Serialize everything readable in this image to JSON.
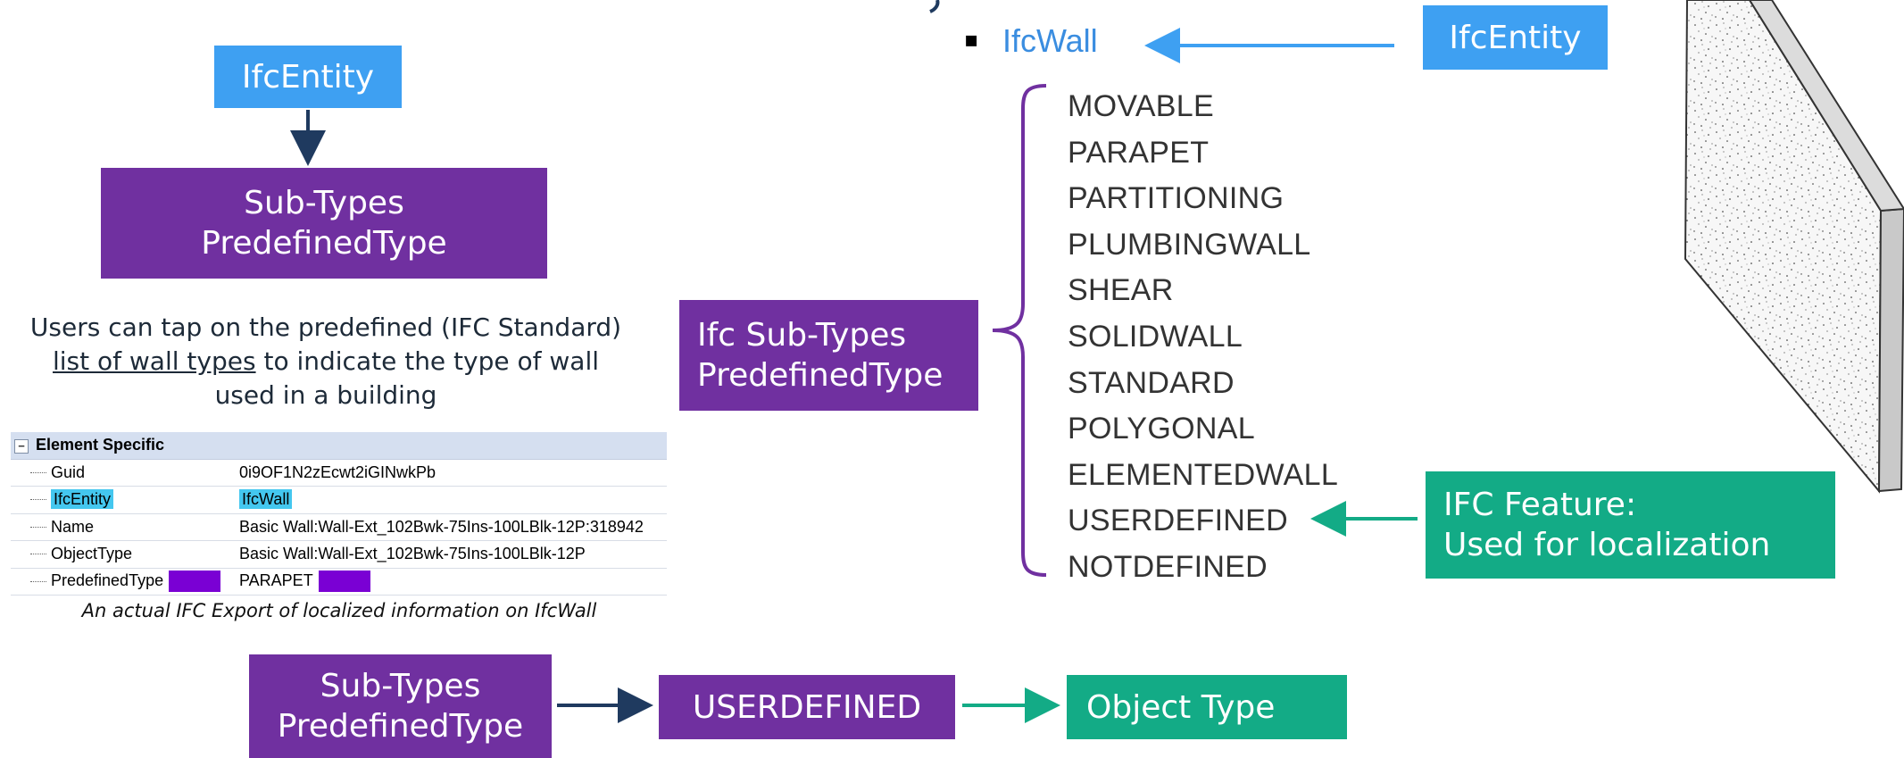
{
  "left_panel": {
    "entity_box": "IfcEntity",
    "subtypes_box": {
      "line1": "Sub-Types",
      "line2": "PredefinedType"
    },
    "description": {
      "line1": "Users can tap on the predefined (IFC Standard)",
      "link": "list of wall types",
      "line2_rest": " to indicate the type of wall",
      "line3": "used in a building"
    },
    "table": {
      "header": "Element Specific",
      "toggle": "−",
      "rows": [
        {
          "key": "Guid",
          "value": "0i9OF1N2zEcwt2iGINwkPb"
        },
        {
          "key": "IfcEntity",
          "value": "IfcWall"
        },
        {
          "key": "Name",
          "value": "Basic Wall:Wall-Ext_102Bwk-75Ins-100LBlk-12P:318942"
        },
        {
          "key": "ObjectType",
          "value": "Basic Wall:Wall-Ext_102Bwk-75Ins-100LBlk-12P"
        },
        {
          "key": "PredefinedType",
          "value": "PARAPET"
        }
      ],
      "caption": "An actual IFC Export of localized information on IfcWall"
    }
  },
  "bottom_flow": {
    "subtypes_box": {
      "line1": "Sub-Types",
      "line2": "PredefinedType"
    },
    "userdefined_box": "USERDEFINED",
    "objecttype_box": "Object Type"
  },
  "right_panel": {
    "bullet": "▪",
    "ifcwall": "IfcWall",
    "entity_box": "IfcEntity",
    "subtypes_box": {
      "line1": "Ifc Sub-Types",
      "line2": "PredefinedType"
    },
    "types": [
      "MOVABLE",
      "PARAPET",
      "PARTITIONING",
      "PLUMBINGWALL",
      "SHEAR",
      "SOLIDWALL",
      "STANDARD",
      "POLYGONAL",
      "ELEMENTEDWALL",
      "USERDEFINED",
      "NOTDEFINED"
    ],
    "feature_box": {
      "line1": "IFC Feature:",
      "line2": "Used for localization"
    }
  },
  "colors": {
    "blue": "#3ea0f2",
    "purple": "#7030a0",
    "green": "#13ab86",
    "navy": "#1f3a5f"
  }
}
